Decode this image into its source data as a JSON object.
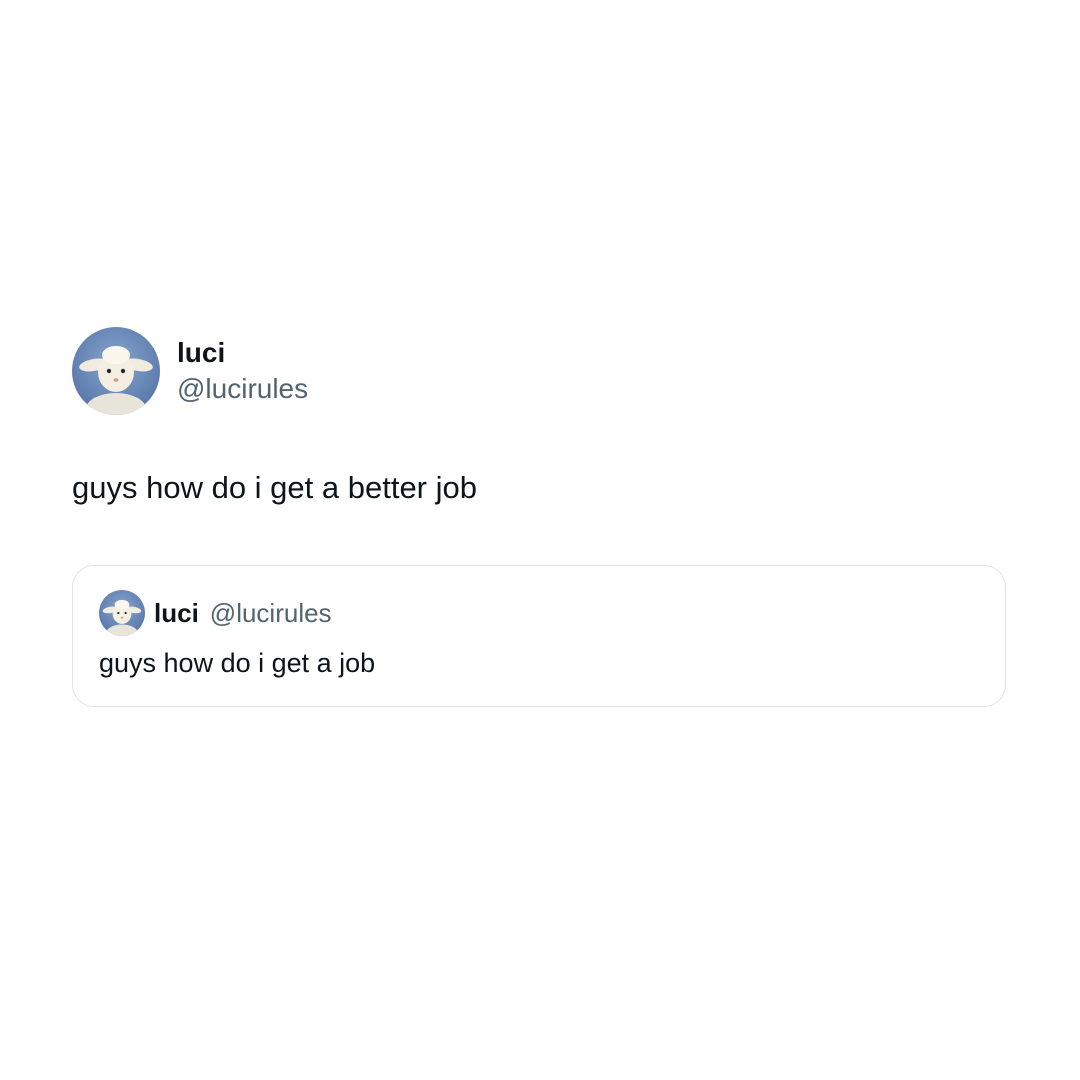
{
  "tweet": {
    "display_name": "luci",
    "handle": "@lucirules",
    "avatar_icon": "sheep-avatar-icon",
    "text": "guys how do i get a better job"
  },
  "quoted_tweet": {
    "display_name": "luci",
    "handle": "@lucirules",
    "avatar_icon": "sheep-avatar-icon",
    "text": "guys how do i get a job"
  },
  "colors": {
    "background": "#ffffff",
    "text_primary": "#0f1419",
    "text_secondary": "#536471",
    "card_border": "#dfe3e6",
    "avatar_sky": "#5b7db0"
  }
}
